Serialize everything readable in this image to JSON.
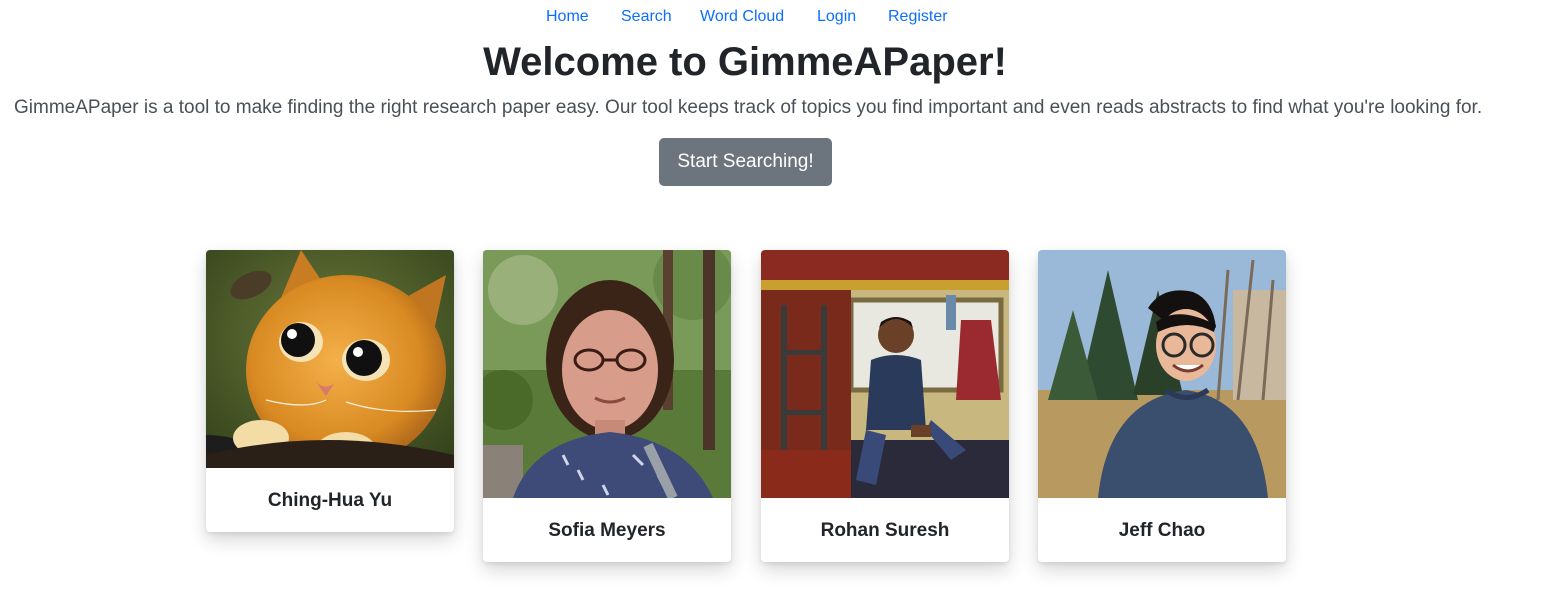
{
  "nav": {
    "items": [
      "Home",
      "Search",
      "Word Cloud",
      "Login",
      "Register"
    ]
  },
  "hero": {
    "title": "Welcome to GimmeAPaper!",
    "lead": "GimmeAPaper is a tool to make finding the right research paper easy. Our tool keeps track of topics you find important and even reads abstracts to find what you're looking for.",
    "button_label": "Start Searching!"
  },
  "team": {
    "members": [
      {
        "name": "Ching-Hua Yu",
        "photo": "orange-cat-photo"
      },
      {
        "name": "Sofia Meyers",
        "photo": "person-portrait-photo"
      },
      {
        "name": "Rohan Suresh",
        "photo": "person-on-train-photo"
      },
      {
        "name": "Jeff Chao",
        "photo": "person-outdoors-photo"
      }
    ]
  },
  "colors": {
    "link": "#0d6efd",
    "button_bg": "#6c757d",
    "heading": "#212529"
  }
}
